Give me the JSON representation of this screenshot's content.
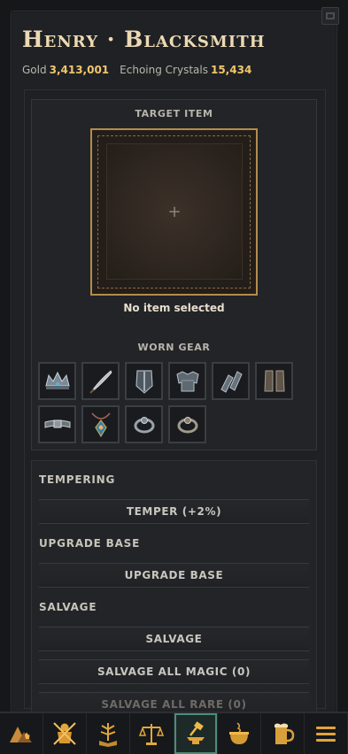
{
  "header": {
    "title": "Henry · Blacksmith",
    "gold_label": "Gold",
    "gold_value": "3,413,001",
    "crystals_label": "Echoing Crystals",
    "crystals_value": "15,434"
  },
  "target": {
    "label": "TARGET ITEM",
    "plus": "+",
    "empty_text": "No item selected"
  },
  "worn_gear": {
    "label": "WORN GEAR",
    "items": [
      "crown-icon",
      "sword-icon",
      "shield-icon",
      "chest-armor-icon",
      "gauntlets-icon",
      "boots-icon",
      "belt-icon",
      "amulet-icon",
      "ring-icon",
      "ring-icon"
    ]
  },
  "actions": {
    "tempering_label": "TEMPERING",
    "temper_button": "TEMPER (+2%)",
    "upgrade_label": "UPGRADE BASE",
    "upgrade_button": "UPGRADE BASE",
    "salvage_label": "SALVAGE",
    "salvage_button": "SALVAGE",
    "salvage_magic_button": "SALVAGE ALL MAGIC (0)",
    "salvage_rare_button": "SALVAGE ALL RARE (0)"
  },
  "nav": {
    "items": [
      "camp-icon",
      "warrior-icon",
      "skill-tree-icon",
      "scales-icon",
      "anvil-hammer-icon",
      "cauldron-icon",
      "tankard-icon",
      "menu-icon"
    ],
    "active": "anvil-hammer-icon"
  },
  "colors": {
    "accent_gold": "#f2c66d",
    "title": "#ecd9b3",
    "slot_border": "#b58c4b",
    "active_nav": "#4c8c7b"
  }
}
